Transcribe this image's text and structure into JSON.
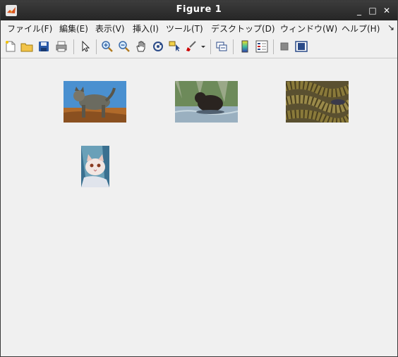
{
  "window": {
    "title": "Figure 1",
    "controls": {
      "minimize": "_",
      "maximize": "□",
      "close": "✕"
    }
  },
  "menu": {
    "items": [
      "ファイル(F)",
      "編集(E)",
      "表示(V)",
      "挿入(I)",
      "ツール(T)",
      "デスクトップ(D)",
      "ウィンドウ(W)",
      "ヘルプ(H)"
    ],
    "overflow_arrow": "↘"
  },
  "toolbar": {
    "icons": [
      "new-figure-icon",
      "open-file-icon",
      "save-icon",
      "print-icon",
      "select-arrow-icon",
      "zoom-in-icon",
      "zoom-out-icon",
      "pan-hand-icon",
      "rotate-3d-icon",
      "data-cursor-icon",
      "brush-icon",
      "brush-dropdown-icon",
      "link-plot-icon",
      "colorbar-icon",
      "legend-icon",
      "hide-plot-tools-icon",
      "show-plot-tools-icon"
    ]
  },
  "images": [
    {
      "subject": "wildcat",
      "colors": {
        "sky": "#4a90d0",
        "ground": "#b06a2a",
        "animal": "#6b6b60"
      }
    },
    {
      "subject": "bear-in-water",
      "colors": {
        "bg": "#6d8a5a",
        "water": "#9ab0c0",
        "animal": "#2a2420"
      }
    },
    {
      "subject": "snakes",
      "colors": {
        "body": "#8a7a3a",
        "stripes": "#4a4020"
      }
    },
    {
      "subject": "kitten",
      "colors": {
        "bg": "#6aa0b8",
        "animal": "#f2e6e2"
      }
    }
  ]
}
